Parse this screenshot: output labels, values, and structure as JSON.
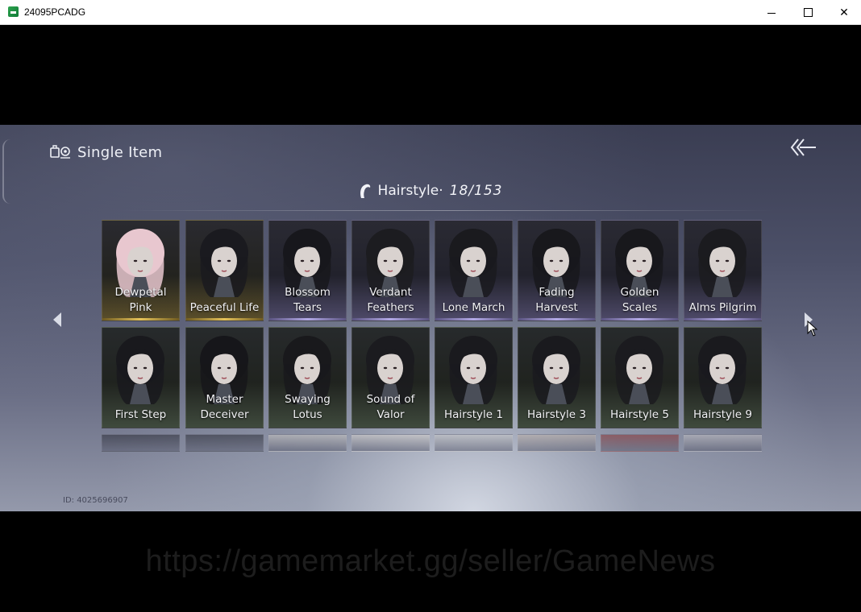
{
  "window": {
    "title": "24095PCADG",
    "minimize_glyph": "–",
    "maximize_glyph": "□",
    "close_glyph": "✕"
  },
  "header": {
    "title": "Single Item",
    "icon": "single-item-icon",
    "back_icon": "double-chevron-back-icon"
  },
  "category": {
    "label": "Hairstyle·",
    "count": "18/153",
    "icon": "hair-icon"
  },
  "navigation": {
    "prev_icon": "triangle-left-icon",
    "next_icon": "triangle-right-icon"
  },
  "items": [
    {
      "label": "Dewpetal Pink",
      "rarity": "gold"
    },
    {
      "label": "Peaceful Life",
      "rarity": "gold"
    },
    {
      "label": "Blossom Tears",
      "rarity": "purple"
    },
    {
      "label": "Verdant Feathers",
      "rarity": "purple"
    },
    {
      "label": "Lone March",
      "rarity": "purple"
    },
    {
      "label": "Fading Harvest",
      "rarity": "purple"
    },
    {
      "label": "Golden Scales",
      "rarity": "purple"
    },
    {
      "label": "Alms Pilgrim",
      "rarity": "purple"
    },
    {
      "label": "First Step",
      "rarity": "green"
    },
    {
      "label": "Master Deceiver",
      "rarity": "green"
    },
    {
      "label": "Swaying Lotus",
      "rarity": "green"
    },
    {
      "label": "Sound of Valor",
      "rarity": "green"
    },
    {
      "label": "Hairstyle 1",
      "rarity": "green"
    },
    {
      "label": "Hairstyle 3",
      "rarity": "green"
    },
    {
      "label": "Hairstyle 5",
      "rarity": "green"
    },
    {
      "label": "Hairstyle 9",
      "rarity": "green"
    }
  ],
  "footer": {
    "id_text": "ID: 4025696907"
  },
  "watermark": "https://gamemarket.gg/seller/GameNews",
  "colors": {
    "gold_accent": "#e6c35a",
    "purple_accent": "#b3a9e6"
  }
}
